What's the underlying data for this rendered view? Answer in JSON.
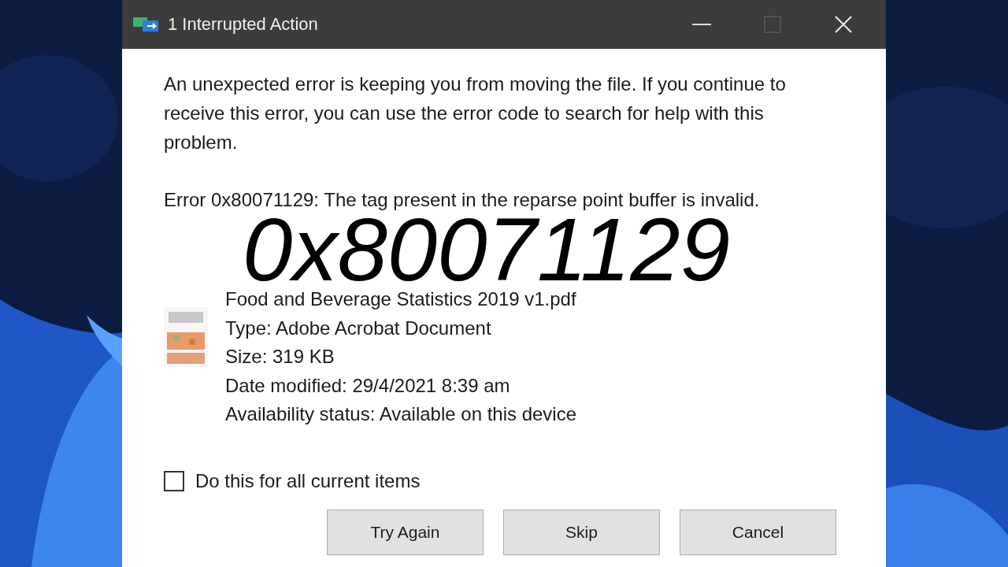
{
  "window": {
    "title": "1 Interrupted Action"
  },
  "message": "An unexpected error is keeping you from moving the file. If you continue to receive this error, you can use the error code to search for help with this problem.",
  "error": "Error 0x80071129: The tag present in the reparse point buffer is invalid.",
  "overlay_caption": "0x80071129",
  "file": {
    "name": "Food and Beverage Statistics 2019 v1.pdf",
    "details": [
      "Type: Adobe Acrobat Document",
      "Size: 319 KB",
      "Date modified: 29/4/2021 8:39 am",
      "Availability status: Available on this device"
    ]
  },
  "apply_all": {
    "label": "Do this for all current items",
    "checked": false
  },
  "buttons": [
    "Try Again",
    "Skip",
    "Cancel"
  ]
}
